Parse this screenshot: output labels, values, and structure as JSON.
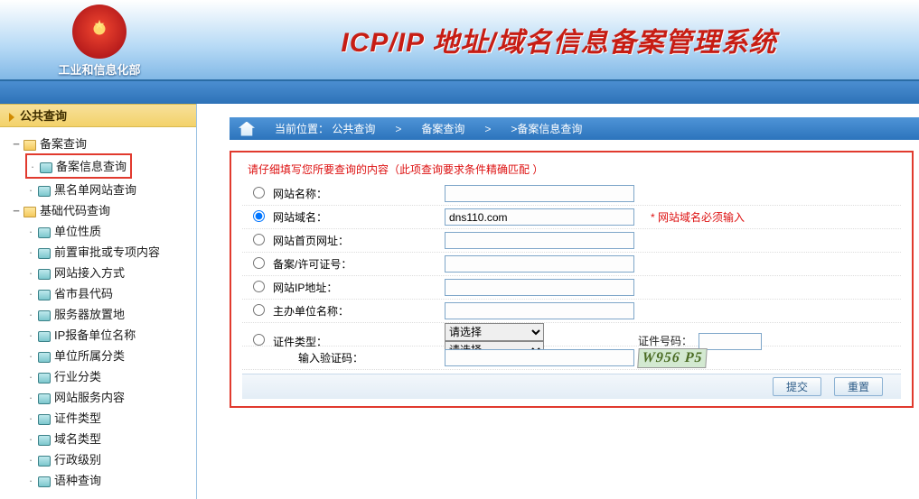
{
  "header": {
    "org": "工业和信息化部",
    "title": "ICP/IP 地址/域名信息备案管理系统"
  },
  "sidebar": {
    "section_title": "公共查询",
    "group1": {
      "label": "备案查询",
      "items": [
        "备案信息查询",
        "黑名单网站查询"
      ]
    },
    "group2": {
      "label": "基础代码查询",
      "items": [
        "单位性质",
        "前置审批或专项内容",
        "网站接入方式",
        "省市县代码",
        "服务器放置地",
        "IP报备单位名称",
        "单位所属分类",
        "行业分类",
        "网站服务内容",
        "证件类型",
        "域名类型",
        "行政级别",
        "语种查询"
      ]
    }
  },
  "breadcrumb": {
    "label_loc": "当前位置：",
    "item1": "公共查询",
    "item2": "备案查询",
    "item3": ">备案信息查询",
    "sep": ">"
  },
  "form": {
    "tip": "请仔细填写您所要查询的内容（此项查询要求条件精确匹配 ）",
    "rows": {
      "site_name": {
        "label": "网站名称：",
        "value": ""
      },
      "domain": {
        "label": "网站域名：",
        "value": "dns110.com",
        "req": "* 网站域名必须输入"
      },
      "home_url": {
        "label": "网站首页网址：",
        "value": ""
      },
      "license": {
        "label": "备案/许可证号：",
        "value": ""
      },
      "ip": {
        "label": "网站IP地址：",
        "value": ""
      },
      "sponsor": {
        "label": "主办单位名称：",
        "value": ""
      },
      "cert_type": {
        "label": "证件类型：",
        "opt": "请选择",
        "cert_no_label": "证件号码：",
        "cert_no": ""
      },
      "captcha": {
        "label": "输入验证码：",
        "value": "",
        "img_text": "W956 P5"
      }
    },
    "buttons": {
      "submit": "提交",
      "reset": "重置"
    }
  }
}
